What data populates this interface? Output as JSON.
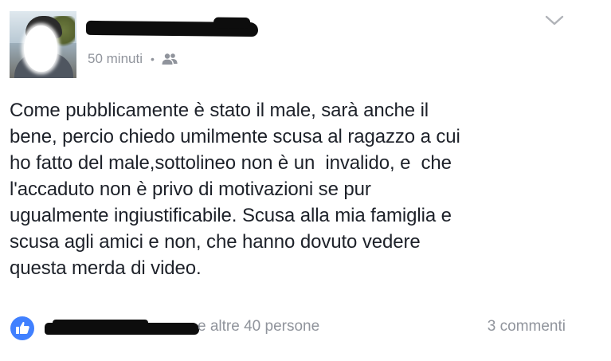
{
  "post": {
    "timestamp": "50 minuti",
    "separator": "•",
    "audience_icon": "friends-icon",
    "menu_icon": "chevron-down-icon",
    "text": "Come pubblicamente è stato il male, sarà anche il\nbene, percio chiedo umilmente scusa al ragazzo a cui\nho fatto del male,sottolineo non è un  invalido, e  che\nl'accaduto non è privo di motivazioni se pur\nugualmente ingiustificabile. Scusa alla mia famiglia e\nscusa agli amici e non, che hanno dovuto vedere\nquesta merda di video."
  },
  "footer": {
    "like_icon": "like-thumb-icon",
    "others_label": "e altre 40 persone",
    "comments_label": "3 commenti"
  },
  "colors": {
    "text": "#1d2129",
    "meta": "#90949c",
    "like_blue": "#4080ff"
  }
}
